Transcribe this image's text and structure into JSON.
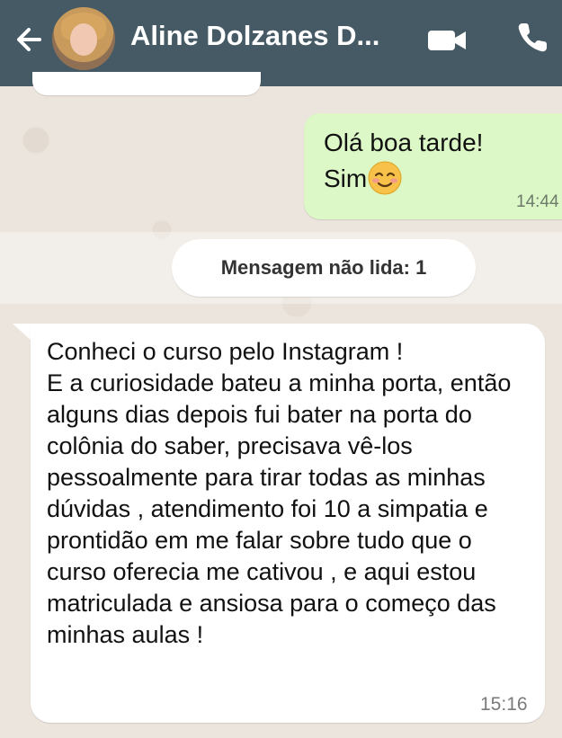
{
  "header": {
    "contact_name": "Aline Dolzanes D...",
    "icons": [
      "back-arrow-icon",
      "video-call-icon",
      "phone-call-icon"
    ],
    "background_color": "#455a64"
  },
  "messages": [
    {
      "direction": "outgoing",
      "text": "Olá boa tarde!\nSim",
      "emoji": "smiling-face-with-smiling-eyes",
      "time": "14:44"
    },
    {
      "direction": "incoming",
      "text": "Conheci o curso pelo Instagram !\nE a curiosidade bateu a minha porta, então alguns dias depois fui bater na porta do colônia do saber, precisava vê-los pessoalmente para tirar todas as minhas dúvidas , atendimento foi 10 a simpatia e prontidão em me falar sobre tudo que o curso oferecia me cativou , e aqui estou matriculada e ansiosa para o começo das minhas aulas !",
      "time": "15:16"
    }
  ],
  "unread_banner": {
    "label": "Mensagem não lida: 1"
  },
  "colors": {
    "outgoing_bubble": "#dcf8c6",
    "incoming_bubble": "#ffffff",
    "chat_background": "#ece5dd"
  }
}
